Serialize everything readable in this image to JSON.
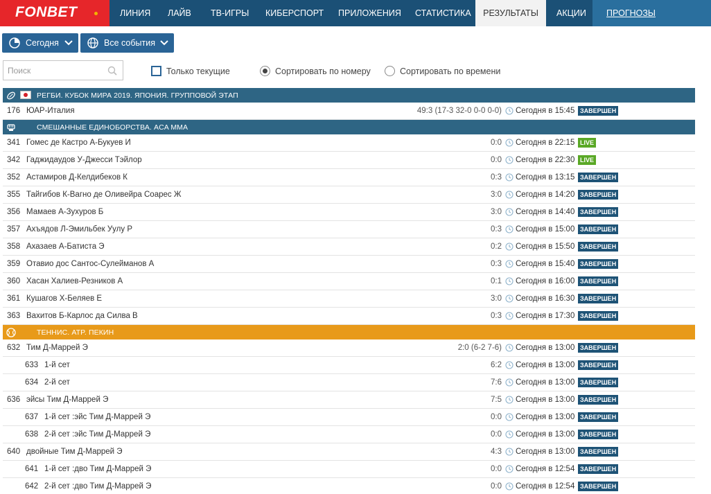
{
  "brand": {
    "name": "FONBET",
    "accent": "#e6262a",
    "nav_bg": "#1b5076"
  },
  "nav": {
    "items": [
      "ЛИНИЯ",
      "ЛАЙВ",
      "ТВ-ИГРЫ",
      "КИБЕРСПОРТ",
      "ПРИЛОЖЕНИЯ",
      "СТАТИСТИКА",
      "РЕЗУЛЬТАТЫ",
      "АКЦИИ",
      "ПРОГНОЗЫ"
    ],
    "active": "РЕЗУЛЬТАТЫ"
  },
  "filters": {
    "date_label": "Сегодня",
    "events_label": "Все события",
    "search_placeholder": "Поиск",
    "only_current": "Только текущие",
    "sort_number": "Сортировать по номеру",
    "sort_time": "Сортировать по времени"
  },
  "sections": [
    {
      "title": "РЕГБИ. КУБОК МИРА 2019. ЯПОНИЯ. ГРУППОВОЙ ЭТАП",
      "icon": "rugby-ball-icon",
      "rows": [
        {
          "num": "176",
          "name": "ЮАР-Италия",
          "score": "49:3 (17-3 32-0 0-0 0-0)",
          "time": "Сегодня в 15:45",
          "status": "ЗАВЕРШЕН"
        }
      ]
    },
    {
      "title": "СМЕШАННЫЕ ЕДИНОБОРСТВА. ACA MMA",
      "icon": "fist-icon",
      "rows": [
        {
          "num": "341",
          "name": "Гомес де Кастро А-Букуев И",
          "score": "0:0",
          "time": "Сегодня в 22:15",
          "status": "LIVE"
        },
        {
          "num": "342",
          "name": "Гаджидаудов У-Джесси Тэйлор",
          "score": "0:0",
          "time": "Сегодня в 22:30",
          "status": "LIVE"
        },
        {
          "num": "352",
          "name": "Астамиров Д-Келдибеков К",
          "score": "0:3",
          "time": "Сегодня в 13:15",
          "status": "ЗАВЕРШЕН"
        },
        {
          "num": "355",
          "name": "Тайгибов К-Вагно де Оливейра Соарес Ж",
          "score": "3:0",
          "time": "Сегодня в 14:20",
          "status": "ЗАВЕРШЕН"
        },
        {
          "num": "356",
          "name": "Мамаев А-Зухуров Б",
          "score": "3:0",
          "time": "Сегодня в 14:40",
          "status": "ЗАВЕРШЕН"
        },
        {
          "num": "357",
          "name": "Ахъядов Л-Эмильбек Уулу Р",
          "score": "0:3",
          "time": "Сегодня в 15:00",
          "status": "ЗАВЕРШЕН"
        },
        {
          "num": "358",
          "name": "Ахазаев А-Батиста Э",
          "score": "0:2",
          "time": "Сегодня в 15:50",
          "status": "ЗАВЕРШЕН"
        },
        {
          "num": "359",
          "name": "Отавио дос Сантос-Сулейманов А",
          "score": "0:3",
          "time": "Сегодня в 15:40",
          "status": "ЗАВЕРШЕН"
        },
        {
          "num": "360",
          "name": "Хасан Халиев-Резников А",
          "score": "0:1",
          "time": "Сегодня в 16:00",
          "status": "ЗАВЕРШЕН"
        },
        {
          "num": "361",
          "name": "Кушагов Х-Беляев Е",
          "score": "3:0",
          "time": "Сегодня в 16:30",
          "status": "ЗАВЕРШЕН"
        },
        {
          "num": "363",
          "name": "Вахитов Б-Карлос да Силва В",
          "score": "0:3",
          "time": "Сегодня в 17:30",
          "status": "ЗАВЕРШЕН"
        }
      ]
    },
    {
      "title": "ТЕННИС. ATP. ПЕКИН",
      "icon": "tennis-ball-icon",
      "rows": [
        {
          "num": "632",
          "name": "Тим Д-Маррей Э",
          "score": "2:0 (6-2 7-6)",
          "time": "Сегодня в 13:00",
          "status": "ЗАВЕРШЕН"
        },
        {
          "num": "633",
          "name": "1-й сет",
          "score": "6:2",
          "time": "Сегодня в 13:00",
          "status": "ЗАВЕРШЕН",
          "sub": true
        },
        {
          "num": "634",
          "name": "2-й сет",
          "score": "7:6",
          "time": "Сегодня в 13:00",
          "status": "ЗАВЕРШЕН",
          "sub": true
        },
        {
          "num": "636",
          "name": "эйсы Тим Д-Маррей Э",
          "score": "7:5",
          "time": "Сегодня в 13:00",
          "status": "ЗАВЕРШЕН"
        },
        {
          "num": "637",
          "name": "1-й сет :эйс Тим Д-Маррей Э",
          "score": "0:0",
          "time": "Сегодня в 13:00",
          "status": "ЗАВЕРШЕН",
          "sub": true
        },
        {
          "num": "638",
          "name": "2-й сет :эйс Тим Д-Маррей Э",
          "score": "0:0",
          "time": "Сегодня в 13:00",
          "status": "ЗАВЕРШЕН",
          "sub": true
        },
        {
          "num": "640",
          "name": "двойные Тим Д-Маррей Э",
          "score": "4:3",
          "time": "Сегодня в 13:00",
          "status": "ЗАВЕРШЕН"
        },
        {
          "num": "641",
          "name": "1-й сет :дво Тим Д-Маррей Э",
          "score": "0:0",
          "time": "Сегодня в 12:54",
          "status": "ЗАВЕРШЕН",
          "sub": true
        },
        {
          "num": "642",
          "name": "2-й сет :дво Тим Д-Маррей Э",
          "score": "0:0",
          "time": "Сегодня в 12:54",
          "status": "ЗАВЕРШЕН",
          "sub": true
        }
      ]
    }
  ]
}
